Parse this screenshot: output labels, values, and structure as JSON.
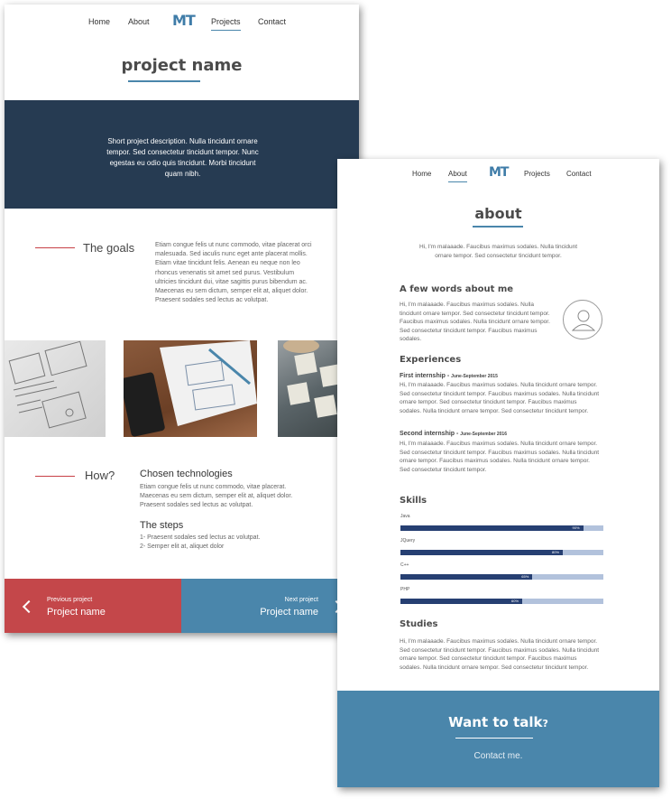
{
  "project_page": {
    "nav": {
      "home": "Home",
      "about": "About",
      "logo": "MT",
      "projects": "Projects",
      "contact": "Contact"
    },
    "title": "project name",
    "hero_text": "Short project description. Nulla tincidunt ornare tempor. Sed consectetur tincidunt tempor. Nunc egestas eu odio quis tincidunt. Morbi tincidunt quam nibh.",
    "goals": {
      "label": "The goals",
      "text": "Etiam congue felis ut nunc commodo, vitae placerat orci malesuada. Sed iaculis nunc eget ante placerat mollis. Etiam vitae tincidunt felis. Aenean eu neque non leo rhoncus venenatis sit amet sed purus. Vestibulum ultricies tincidunt dui, vitae sagittis purus bibendum ac. Maecenas eu sem dictum, semper elit at, aliquet dolor. Praesent sodales sed lectus ac volutpat."
    },
    "how": {
      "label": "How?",
      "tech_heading": "Chosen technologies",
      "tech_text": "Etiam congue felis ut nunc commodo, vitae placerat. Maecenas eu sem dictum, semper elit at, aliquet dolor. Praesent sodales sed lectus ac volutpat.",
      "steps_heading": "The steps",
      "step1": "1- Praesent sodales sed lectus ac volutpat.",
      "step2": "2- Semper elit at, aliquet dolor"
    },
    "prev": {
      "small": "Previous project",
      "big": "Project name"
    },
    "next": {
      "small": "Next project",
      "big": "Project name"
    },
    "colors": {
      "hero": "#263b52",
      "prev": "#c4474a",
      "next": "#4a86ab",
      "accent": "#4a86ab",
      "red_line": "#c74046"
    }
  },
  "about_page": {
    "nav": {
      "home": "Home",
      "about": "About",
      "logo": "MT",
      "projects": "Projects",
      "contact": "Contact"
    },
    "title": "about",
    "intro": "Hi, I'm malaaade. Faucibus maximus sodales. Nulla tincidunt ornare tempor. Sed consectetur tincidunt tempor.",
    "few_words": {
      "heading": "A few words about me",
      "text": "Hi, I'm malaaade. Faucibus maximus sodales. Nulla tincidunt ornare tempor. Sed consectetur tincidunt tempor. Faucibus maximus sodales. Nulla tincidunt ornare tempor. Sed consectetur tincidunt tempor. Faucibus maximus sodales."
    },
    "experiences": {
      "heading": "Experiences",
      "first_title": "First internship - ",
      "first_date": "June-September 2015",
      "first_text": "Hi, I'm malaaade. Faucibus maximus sodales. Nulla tincidunt ornare tempor. Sed consectetur tincidunt tempor. Faucibus maximus sodales. Nulla tincidunt ornare tempor. Sed consectetur tincidunt tempor. Faucibus maximus sodales. Nulla tincidunt ornare tempor. Sed consectetur tincidunt tempor.",
      "second_title": "Second internship - ",
      "second_date": "June-September 2016",
      "second_text": "Hi, I'm malaaade. Faucibus maximus sodales. Nulla tincidunt ornare tempor. Sed consectetur tincidunt tempor. Faucibus maximus sodales. Nulla tincidunt ornare tempor. Faucibus maximus sodales. Nulla tincidunt ornare tempor. Sed consectetur tincidunt tempor."
    },
    "skills": {
      "heading": "Skills",
      "items": [
        {
          "name": "Java",
          "percent": 90,
          "label": "90%"
        },
        {
          "name": "JQuery",
          "percent": 80,
          "label": "80%"
        },
        {
          "name": "C++",
          "percent": 65,
          "label": "65%"
        },
        {
          "name": "PHP",
          "percent": 60,
          "label": "60%"
        }
      ]
    },
    "studies": {
      "heading": "Studies",
      "text": "Hi, I'm malaaade. Faucibus maximus sodales. Nulla tincidunt ornare tempor. Sed consectetur tincidunt tempor. Faucibus maximus sodales. Nulla tincidunt ornare tempor. Sed consectetur tincidunt tempor. Faucibus maximus sodales. Nulla tincidunt ornare tempor. Sed consectetur tincidunt tempor."
    },
    "talk": {
      "title": "Want to talk",
      "question_mark": "?",
      "link": "Contact me."
    },
    "colors": {
      "bar_fill": "#263f72",
      "bar_track": "#b2c2dc",
      "talk_bg": "#4a86ab"
    }
  }
}
